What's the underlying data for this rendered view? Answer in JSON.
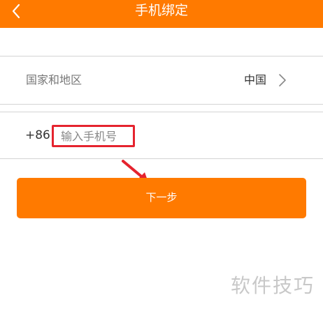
{
  "header": {
    "title": "手机绑定",
    "back_icon": "chevron-left-icon"
  },
  "region": {
    "label": "国家和地区",
    "value": "中国",
    "chevron_icon": "chevron-right-icon"
  },
  "phone": {
    "country_code": "+86",
    "value": "",
    "placeholder": "输入手机号"
  },
  "next_button": {
    "label": "下一步"
  },
  "watermark": "软件技巧",
  "colors": {
    "brand_orange": "#ff7a00",
    "annotation_red": "#e5232e",
    "divider": "#d4d4d4"
  }
}
